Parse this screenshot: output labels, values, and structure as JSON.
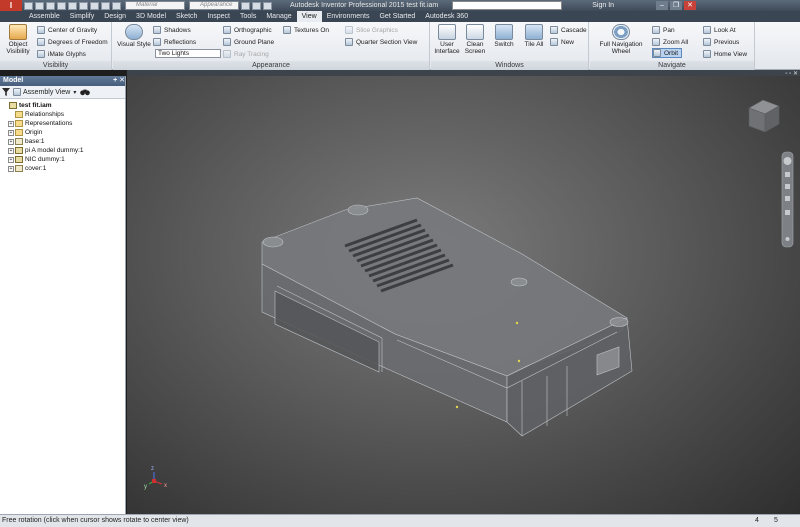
{
  "titlebar": {
    "logo": "I",
    "material_placeholder": "Material",
    "appearance_placeholder": "Appearance",
    "title": "Autodesk Inventor Professional 2015   test fit.iam",
    "sign_in": "Sign In",
    "controls": [
      "–",
      "❐",
      "✕"
    ]
  },
  "tabs": [
    "Assemble",
    "Simplify",
    "Design",
    "3D Model",
    "Sketch",
    "Inspect",
    "Tools",
    "Manage",
    "View",
    "Environments",
    "Get Started",
    "Autodesk 360"
  ],
  "active_tab": "View",
  "ribbon": {
    "visibility": {
      "label": "Visibility",
      "object_visibility": "Object\nVisibility",
      "center_of_gravity": "Center of Gravity",
      "degrees_of_freedom": "Degrees of Freedom",
      "imate_glyphs": "iMate Glyphs"
    },
    "appearance": {
      "label": "Appearance",
      "visual_style": "Visual Style",
      "shadows": "Shadows",
      "reflections": "Reflections",
      "lighting_value": "Two Lights",
      "orthographic": "Orthographic",
      "ground_plane": "Ground Plane",
      "ray_tracing": "Ray Tracing",
      "textures_on": "Textures On",
      "slice_graphics": "Slice Graphics",
      "quarter_section_view": "Quarter Section View"
    },
    "windows": {
      "label": "Windows",
      "user_interface": "User\nInterface",
      "clean_screen": "Clean\nScreen",
      "switch": "Switch",
      "tile_all": "Tile All",
      "cascade": "Cascade",
      "new": "New"
    },
    "navigate": {
      "label": "Navigate",
      "full_navigation_wheel": "Full Navigation\nWheel",
      "pan": "Pan",
      "zoom_all": "Zoom All",
      "orbit": "Orbit",
      "look_at": "Look At",
      "previous": "Previous",
      "home_view": "Home View"
    }
  },
  "browser": {
    "title": "Model",
    "view_select": "Assembly View",
    "tree": [
      {
        "label": "test fit.iam",
        "depth": 0,
        "expander": "",
        "kind": "asm",
        "bold": true
      },
      {
        "label": "Relationships",
        "depth": 1,
        "expander": "",
        "kind": "folder"
      },
      {
        "label": "Representations",
        "depth": 1,
        "expander": "+",
        "kind": "folder"
      },
      {
        "label": "Origin",
        "depth": 1,
        "expander": "+",
        "kind": "folder"
      },
      {
        "label": "base:1",
        "depth": 1,
        "expander": "+",
        "kind": "part"
      },
      {
        "label": "pi A model dummy:1",
        "depth": 1,
        "expander": "+",
        "kind": "asm"
      },
      {
        "label": "NIC dummy:1",
        "depth": 1,
        "expander": "+",
        "kind": "asm"
      },
      {
        "label": "cover:1",
        "depth": 1,
        "expander": "+",
        "kind": "part"
      }
    ]
  },
  "viewport": {
    "axis_labels": {
      "x": "x",
      "y": "y",
      "z": "z"
    }
  },
  "statusbar": {
    "message": "Free rotation (click when cursor shows rotate to center view)",
    "count_a": "4",
    "count_b": "5"
  },
  "colors": {
    "ribbon_bg": "#e9edf1",
    "tab_bar": "#3b4654",
    "browser_header": "#556d8c",
    "viewport_center": "#7b7b7b",
    "viewport_edge": "#2e2e2e"
  }
}
